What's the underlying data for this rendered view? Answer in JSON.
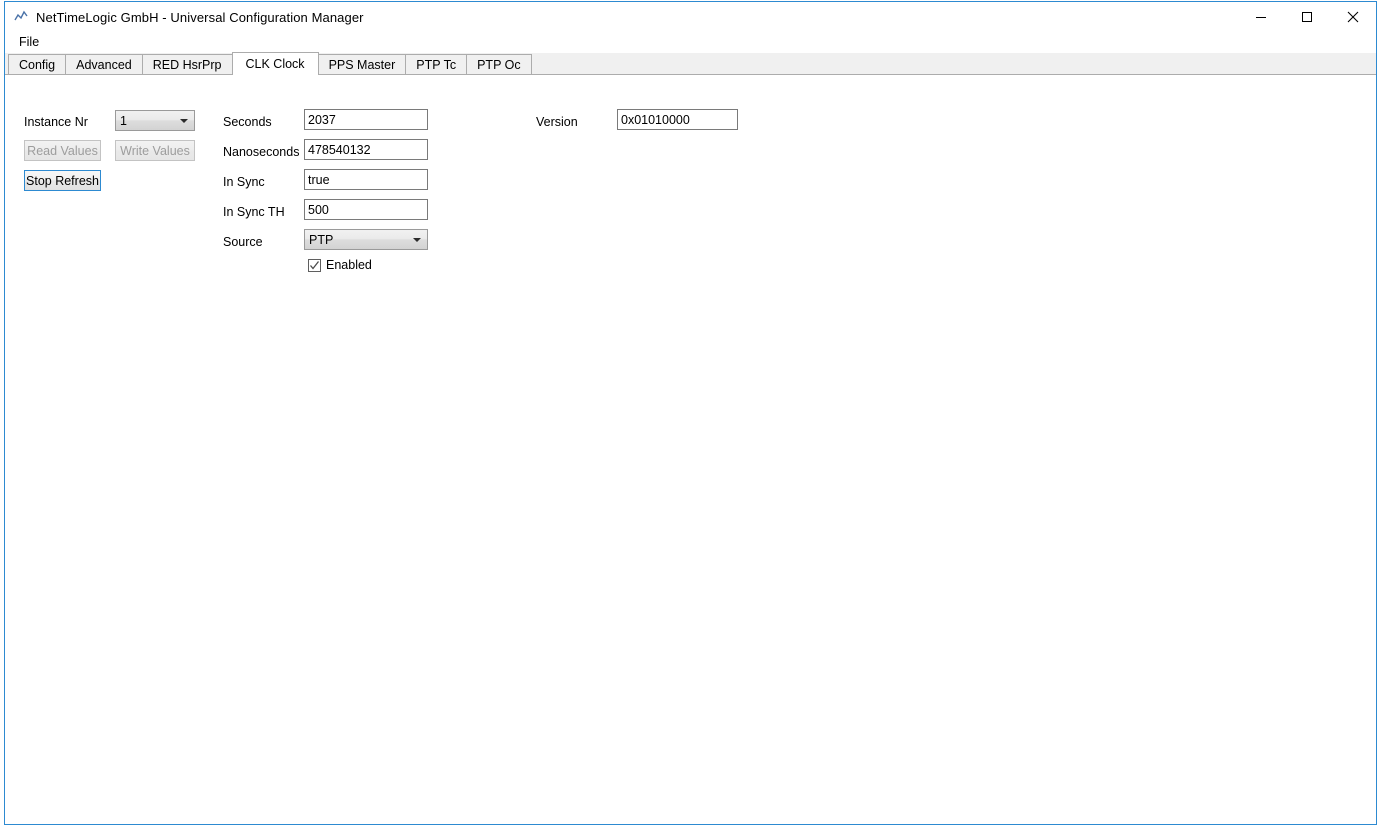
{
  "window": {
    "title": "NetTimeLogic GmbH - Universal Configuration Manager",
    "icon": "chart-line-icon",
    "border_color": "#2d8ad1",
    "controls": {
      "minimize": "minimize-icon",
      "maximize": "maximize-icon",
      "close": "close-icon"
    }
  },
  "menubar": {
    "items": [
      {
        "label": "File"
      }
    ]
  },
  "tabs": [
    {
      "label": "Config",
      "selected": false
    },
    {
      "label": "Advanced",
      "selected": false
    },
    {
      "label": "RED HsrPrp",
      "selected": false
    },
    {
      "label": "CLK Clock",
      "selected": true
    },
    {
      "label": "PPS Master",
      "selected": false
    },
    {
      "label": "PTP Tc",
      "selected": false
    },
    {
      "label": "PTP Oc",
      "selected": false
    }
  ],
  "panel": {
    "instance": {
      "label": "Instance Nr",
      "value": "1",
      "options": [
        "1"
      ]
    },
    "buttons": {
      "read": {
        "label": "Read Values",
        "enabled": false
      },
      "write": {
        "label": "Write Values",
        "enabled": false
      },
      "refresh": {
        "label": "Stop Refresh",
        "enabled": true,
        "focused": true
      }
    },
    "fields": [
      {
        "label": "Seconds",
        "value": "2037",
        "type": "text"
      },
      {
        "label": "Nanoseconds",
        "value": "478540132",
        "type": "text"
      },
      {
        "label": "In Sync",
        "value": "true",
        "type": "text"
      },
      {
        "label": "In Sync TH",
        "value": "500",
        "type": "text"
      },
      {
        "label": "Source",
        "value": "PTP",
        "type": "combo",
        "options": [
          "PTP"
        ]
      }
    ],
    "enabled_checkbox": {
      "label": "Enabled",
      "checked": true
    },
    "version": {
      "label": "Version",
      "value": "0x01010000"
    }
  }
}
